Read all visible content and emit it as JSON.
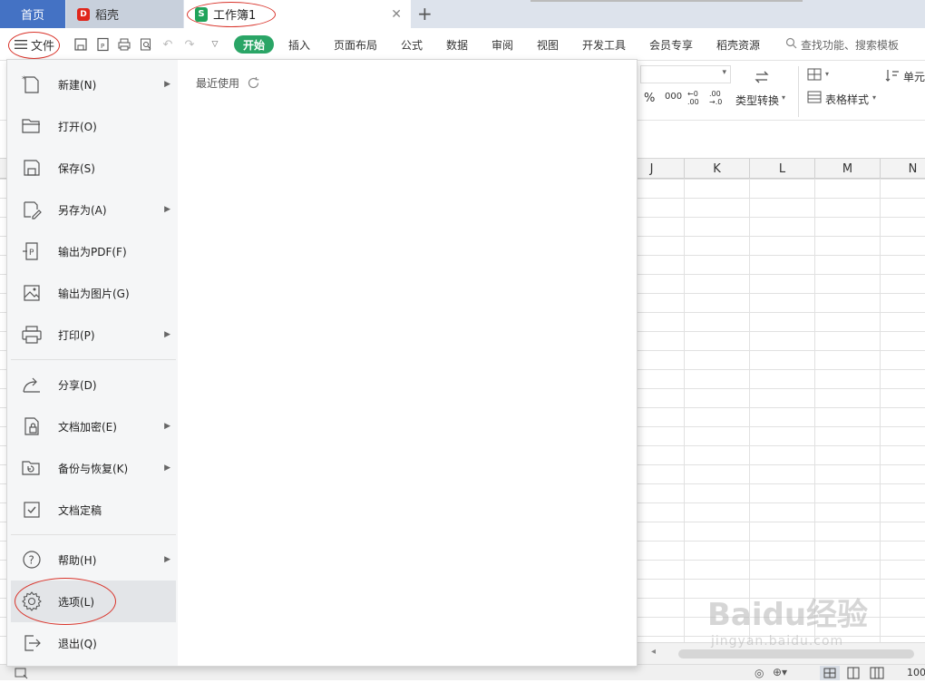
{
  "tabs": {
    "home": "首页",
    "daoke": "稻壳",
    "workbook": "工作簿1",
    "close_glyph": "✕",
    "add_glyph": "+"
  },
  "menubar": {
    "file_label": "文件",
    "ribbon_tabs": [
      "开始",
      "插入",
      "页面布局",
      "公式",
      "数据",
      "审阅",
      "视图",
      "开发工具",
      "会员专享",
      "稻壳资源"
    ],
    "search_placeholder": "查找功能、搜索模板"
  },
  "ribbon": {
    "type_convert": "类型转换",
    "table_style": "表格样式",
    "cell_partial": "单元",
    "percent": "%",
    "thousands": "000",
    "inc_decimal": "←0 .00",
    "dec_decimal": ".00 →.0"
  },
  "sheet": {
    "columns": [
      "J",
      "K",
      "L",
      "M",
      "N"
    ]
  },
  "file_menu": {
    "recent_label": "最近使用",
    "items": [
      {
        "label": "新建(N)",
        "icon": "new-file-icon",
        "submenu": true
      },
      {
        "label": "打开(O)",
        "icon": "folder-open-icon",
        "submenu": false
      },
      {
        "label": "保存(S)",
        "icon": "save-icon",
        "submenu": false
      },
      {
        "label": "另存为(A)",
        "icon": "save-as-icon",
        "submenu": true
      },
      {
        "label": "输出为PDF(F)",
        "icon": "export-pdf-icon",
        "submenu": false
      },
      {
        "label": "输出为图片(G)",
        "icon": "export-image-icon",
        "submenu": false
      },
      {
        "label": "打印(P)",
        "icon": "printer-icon",
        "submenu": true
      },
      {
        "label": "分享(D)",
        "icon": "share-icon",
        "submenu": false
      },
      {
        "label": "文档加密(E)",
        "icon": "lock-document-icon",
        "submenu": true
      },
      {
        "label": "备份与恢复(K)",
        "icon": "backup-icon",
        "submenu": true
      },
      {
        "label": "文档定稿",
        "icon": "finalize-icon",
        "submenu": false
      },
      {
        "label": "帮助(H)",
        "icon": "help-icon",
        "submenu": true
      },
      {
        "label": "选项(L)",
        "icon": "gear-icon",
        "submenu": false
      },
      {
        "label": "退出(Q)",
        "icon": "exit-icon",
        "submenu": false
      }
    ]
  },
  "statusbar": {
    "zoom_partial": "100"
  },
  "watermark": {
    "main": "Baidu经验",
    "sub": "jingyan.baidu.com"
  },
  "colors": {
    "accent_green": "#2aa566",
    "home_tab_blue": "#4472c4",
    "annotation_red": "#d9342b"
  }
}
